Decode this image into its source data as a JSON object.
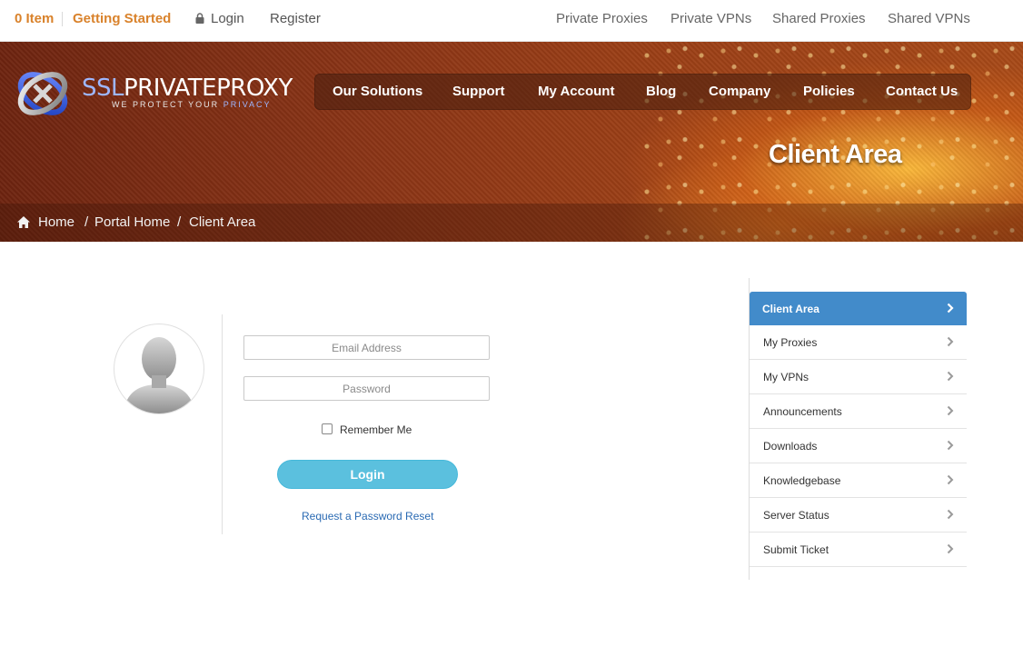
{
  "topbar": {
    "cart": "0 Item",
    "getting_started": "Getting Started",
    "login": "Login",
    "register": "Register",
    "links": [
      "Private Proxies",
      "Private VPNs",
      "Shared Proxies",
      "Shared VPNs"
    ]
  },
  "brand": {
    "ssl": "SSL",
    "name": "PRIVATEPROXY",
    "tagline_a": "WE PROTECT YOUR ",
    "tagline_b": "PRIVACY"
  },
  "nav": [
    "Our Solutions",
    "Support",
    "My Account",
    "Blog",
    "Company",
    "Policies",
    "Contact Us"
  ],
  "page_title": "Client Area",
  "breadcrumb": [
    "Home",
    "Portal Home",
    "Client Area"
  ],
  "breadcrumb_sep": "/",
  "login": {
    "email_placeholder": "Email Address",
    "password_placeholder": "Password",
    "remember": "Remember Me",
    "button": "Login",
    "reset": "Request a Password Reset"
  },
  "sidebar": {
    "items": [
      {
        "label": "Client Area",
        "active": true
      },
      {
        "label": "My Proxies"
      },
      {
        "label": "My VPNs"
      },
      {
        "label": "Announcements"
      },
      {
        "label": "Downloads"
      },
      {
        "label": "Knowledgebase"
      },
      {
        "label": "Server Status"
      },
      {
        "label": "Submit Ticket"
      }
    ]
  },
  "colors": {
    "accent_orange": "#d9822b",
    "active_menu": "#428bca",
    "login_button": "#5bc0de",
    "link": "#2a6ab3"
  }
}
